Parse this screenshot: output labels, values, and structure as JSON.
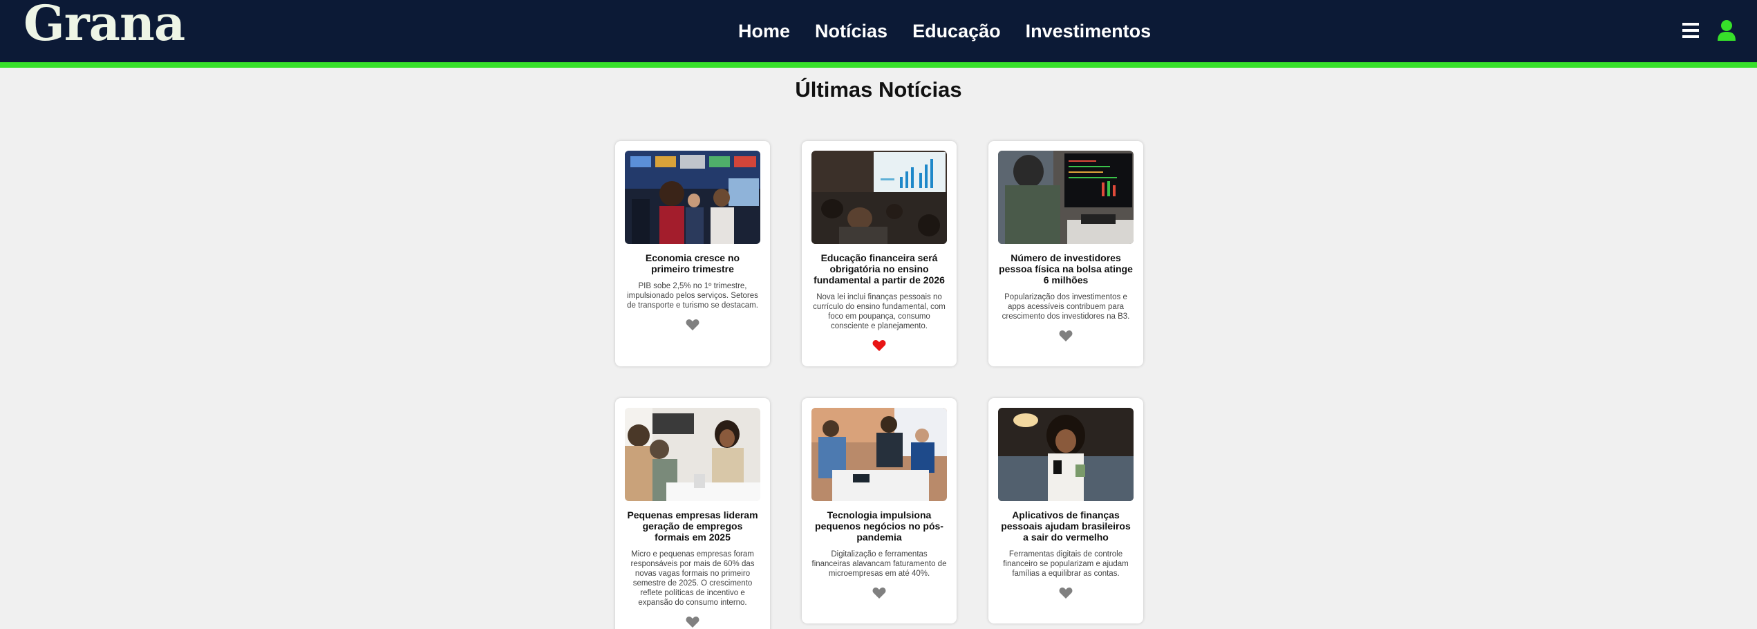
{
  "brand": {
    "name": "Grana",
    "accent_color": "#37e02a",
    "header_bg": "#0c1a36",
    "logo_color": "#eef5e6"
  },
  "nav": {
    "items": [
      {
        "label": "Home"
      },
      {
        "label": "Notícias"
      },
      {
        "label": "Educação"
      },
      {
        "label": "Investimentos"
      }
    ]
  },
  "icons": {
    "menu": "hamburger-menu-icon",
    "user": "user-profile-icon",
    "like": "heart-icon"
  },
  "page": {
    "title": "Últimas Notícias"
  },
  "articles": [
    {
      "title": "Economia cresce no primeiro trimestre",
      "summary": "PIB sobe 2,5% no 1º trimestre, impulsionado pelos serviços. Setores de transporte e turismo se destacam.",
      "liked": false
    },
    {
      "title": "Educação financeira será obrigatória no ensino fundamental a partir de 2026",
      "summary": "Nova lei inclui finanças pessoais no currículo do ensino fundamental, com foco em poupança, consumo consciente e planejamento.",
      "liked": true
    },
    {
      "title": "Número de investidores pessoa física na bolsa atinge 6 milhões",
      "summary": "Popularização dos investimentos e apps acessíveis contribuem para crescimento dos investidores na B3.",
      "liked": false
    },
    {
      "title": "Pequenas empresas lideram geração de empregos formais em 2025",
      "summary": "Micro e pequenas empresas foram responsáveis por mais de 60% das novas vagas formais no primeiro semestre de 2025. O crescimento reflete políticas de incentivo e expansão do consumo interno.",
      "liked": false
    },
    {
      "title": "Tecnologia impulsiona pequenos negócios no pós-pandemia",
      "summary": "Digitalização e ferramentas financeiras alavancam faturamento de microempresas em até 40%.",
      "liked": false
    },
    {
      "title": "Aplicativos de finanças pessoais ajudam brasileiros a sair do vermelho",
      "summary": "Ferramentas digitais de controle financeiro se popularizam e ajudam famílias a equilibrar as contas.",
      "liked": false
    }
  ],
  "like_colors": {
    "liked": "#e81414",
    "unliked": "#808080"
  }
}
